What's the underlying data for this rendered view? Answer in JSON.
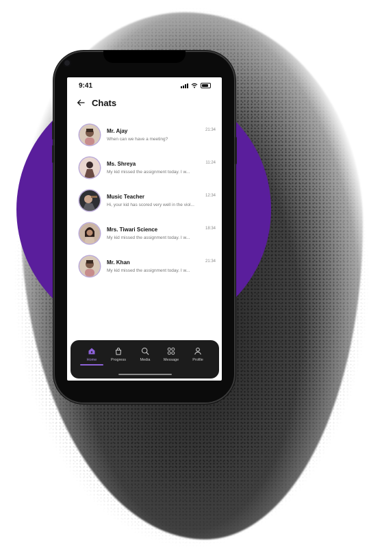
{
  "status_bar": {
    "time": "9:41"
  },
  "header": {
    "title": "Chats"
  },
  "chats": [
    {
      "name": "Mr. Ajay",
      "preview": "When can we have a meeting?",
      "time": "21:34"
    },
    {
      "name": "Ms. Shreya",
      "preview": "My kid missed the assignment today. I w...",
      "time": "11:24"
    },
    {
      "name": "Music Teacher",
      "preview": "Hi, your kid has scored very well in the viol...",
      "time": "12:34"
    },
    {
      "name": "Mrs. Tiwari Science",
      "preview": "My kid missed the assignment today. I w...",
      "time": "18:34"
    },
    {
      "name": "Mr. Khan",
      "preview": "My kid missed the assignment today. I w...",
      "time": "21:34"
    }
  ],
  "nav": {
    "items": [
      {
        "label": "Home",
        "icon": "home-icon"
      },
      {
        "label": "Progress",
        "icon": "bag-icon"
      },
      {
        "label": "Media",
        "icon": "search-icon"
      },
      {
        "label": "Message",
        "icon": "grid-icon"
      },
      {
        "label": "Profile",
        "icon": "person-icon"
      }
    ],
    "active": "Home"
  },
  "colors": {
    "accent": "#8d62d8",
    "backdrop": "#5a1e9c",
    "nav_bg": "#1c1c1c"
  }
}
